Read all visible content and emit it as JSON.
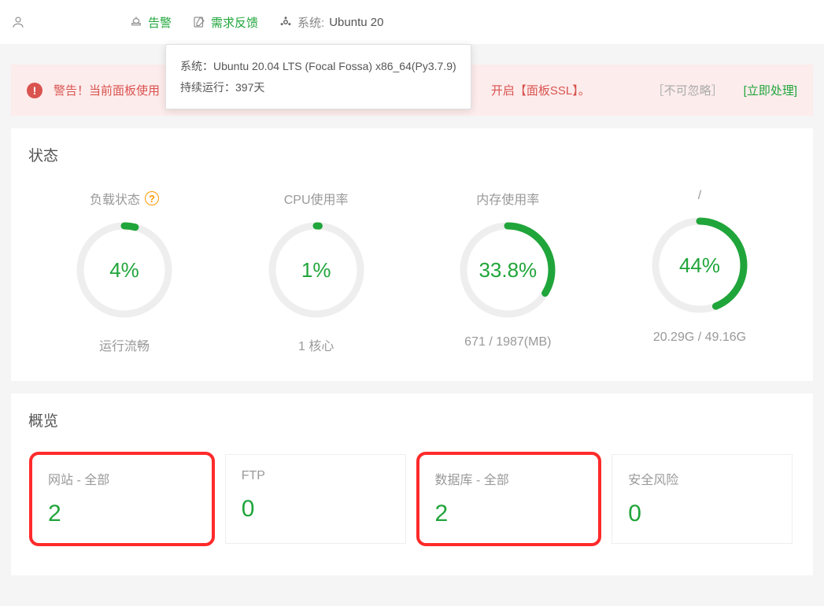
{
  "topbar": {
    "alarm_label": "告警",
    "feedback_label": "需求反馈",
    "system_prefix": "系统:",
    "system_short": "Ubuntu 20"
  },
  "tooltip": {
    "line1": "系统：Ubuntu 20.04 LTS (Focal Fossa) x86_64(Py3.7.9)",
    "line2": "持续运行：397天"
  },
  "alert": {
    "text_left": "警告！当前面板使用",
    "text_right": "开启【面板SSL】。",
    "ignore": "［不可忽略］",
    "handle": "[立即处理]"
  },
  "status": {
    "title": "状态",
    "gauges": [
      {
        "label": "负载状态",
        "help": true,
        "value": "4%",
        "pct": 4,
        "footer": "运行流畅"
      },
      {
        "label": "CPU使用率",
        "help": false,
        "value": "1%",
        "pct": 1,
        "footer": "1 核心"
      },
      {
        "label": "内存使用率",
        "help": false,
        "value": "33.8%",
        "pct": 33.8,
        "footer": "671 / 1987(MB)"
      },
      {
        "label": "/",
        "help": false,
        "value": "44%",
        "pct": 44,
        "footer": "20.29G / 49.16G"
      }
    ]
  },
  "overview": {
    "title": "概览",
    "cards": [
      {
        "title": "网站 - 全部",
        "value": "2",
        "highlight": true
      },
      {
        "title": "FTP",
        "value": "0",
        "highlight": false
      },
      {
        "title": "数据库 - 全部",
        "value": "2",
        "highlight": true
      },
      {
        "title": "安全风险",
        "value": "0",
        "highlight": false
      }
    ]
  }
}
